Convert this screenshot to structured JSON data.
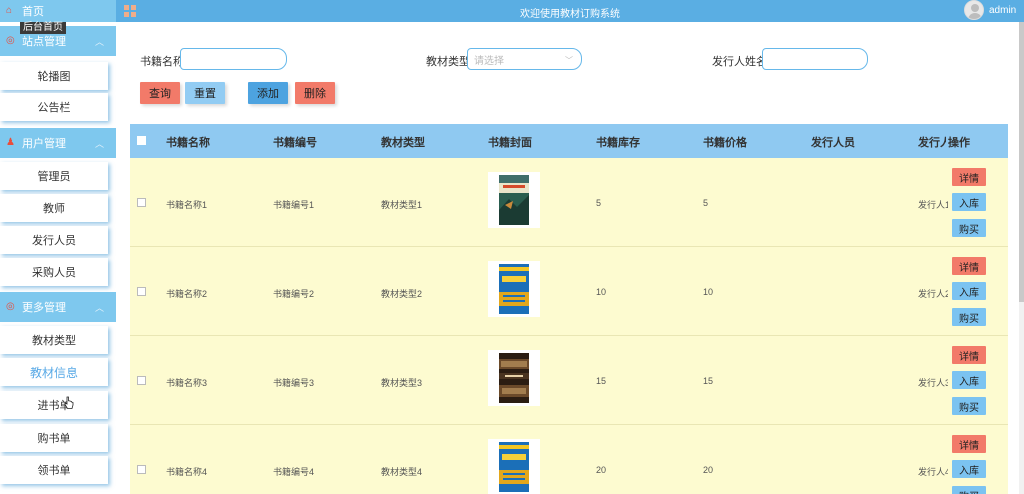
{
  "header": {
    "title": "欢迎使用教材订购系统",
    "user": "admin",
    "colors": {
      "bar": "#5aaee3",
      "accent": "#7ec8ee"
    }
  },
  "sidebar": {
    "home": "首页",
    "tooltip": "后台首页",
    "groups": [
      {
        "label": "站点管理",
        "icon": "site-icon",
        "items": [
          "轮播图",
          "公告栏"
        ]
      },
      {
        "label": "用户管理",
        "icon": "user-icon",
        "items": [
          "管理员",
          "教师",
          "发行人员",
          "采购人员"
        ]
      },
      {
        "label": "更多管理",
        "icon": "more-icon",
        "items": [
          "教材类型",
          "教材信息",
          "进书单",
          "购书单",
          "领书单"
        ]
      }
    ],
    "active_item": "教材信息"
  },
  "search": {
    "name_label": "书籍名称",
    "type_label": "教材类型",
    "type_placeholder": "请选择",
    "publisher_label": "发行人姓名",
    "buttons": {
      "query": "查询",
      "reset": "重置",
      "add": "添加",
      "delete": "删除"
    }
  },
  "table": {
    "columns": [
      "书籍名称",
      "书籍编号",
      "教材类型",
      "书籍封面",
      "书籍库存",
      "书籍价格",
      "发行人员",
      "发行人",
      "操作"
    ],
    "rows": [
      {
        "name": "书籍名称1",
        "code": "书籍编号1",
        "type": "教材类型1",
        "stock": "5",
        "price": "5",
        "publisher": "发行人1",
        "cover": "book-cover-green"
      },
      {
        "name": "书籍名称2",
        "code": "书籍编号2",
        "type": "教材类型2",
        "stock": "10",
        "price": "10",
        "publisher": "发行人2",
        "cover": "book-cover-blue"
      },
      {
        "name": "书籍名称3",
        "code": "书籍编号3",
        "type": "教材类型3",
        "stock": "15",
        "price": "15",
        "publisher": "发行人3",
        "cover": "book-cover-dark"
      },
      {
        "name": "书籍名称4",
        "code": "书籍编号4",
        "type": "教材类型4",
        "stock": "20",
        "price": "20",
        "publisher": "发行人4",
        "cover": "book-cover-blue"
      }
    ],
    "actions": {
      "detail": "详情",
      "stock_in": "入库",
      "buy": "购买"
    }
  }
}
